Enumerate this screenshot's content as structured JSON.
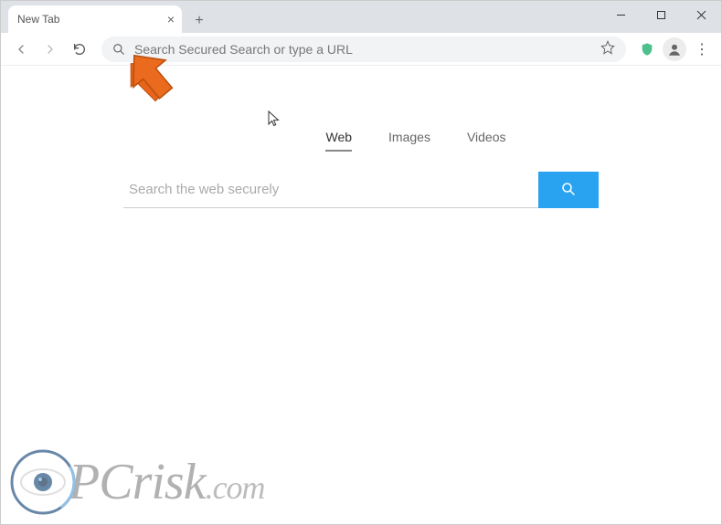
{
  "window": {
    "tab_title": "New Tab"
  },
  "toolbar": {
    "omnibox_placeholder": "Search Secured Search or type a URL"
  },
  "page": {
    "tabs": {
      "web": "Web",
      "images": "Images",
      "videos": "Videos"
    },
    "search_placeholder": "Search the web securely"
  },
  "watermark": {
    "prefix": "PC",
    "mid": "risk",
    "suffix": ".com"
  }
}
